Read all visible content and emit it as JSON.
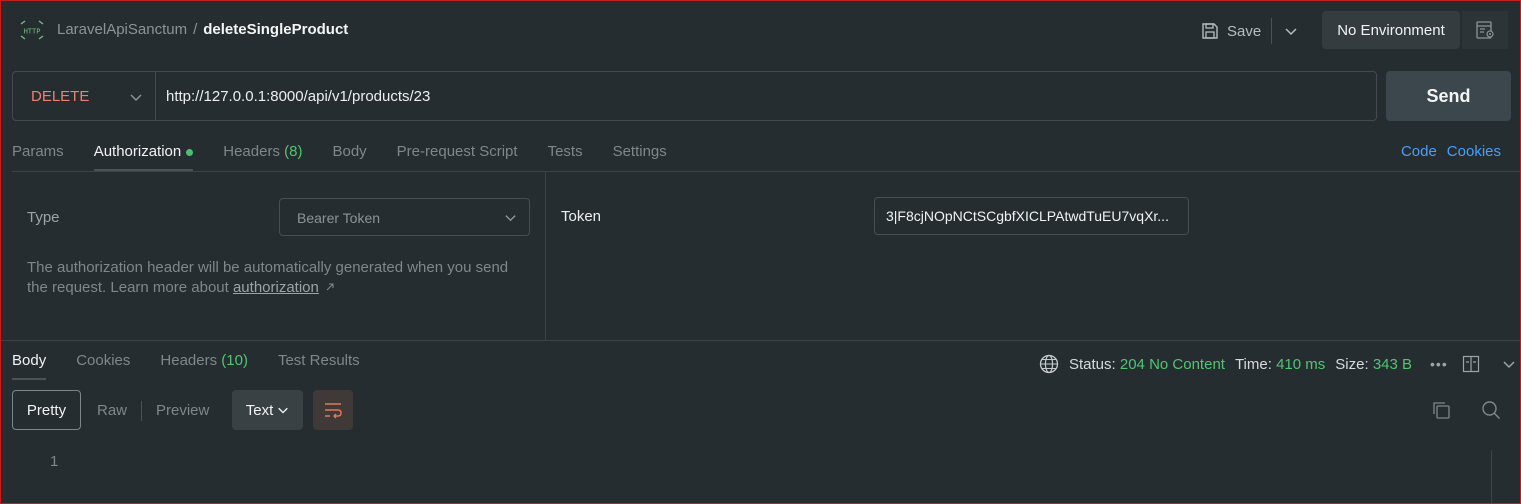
{
  "header": {
    "collection": "LaravelApiSanctum",
    "separator": "/",
    "request_name": "deleteSingleProduct",
    "save_label": "Save",
    "environment": "No Environment"
  },
  "request": {
    "method": "DELETE",
    "url": "http://127.0.0.1:8000/api/v1/products/23",
    "send_label": "Send",
    "tabs": [
      {
        "label": "Params"
      },
      {
        "label": "Authorization"
      },
      {
        "label": "Headers",
        "count": "(8)"
      },
      {
        "label": "Body"
      },
      {
        "label": "Pre-request Script"
      },
      {
        "label": "Tests"
      },
      {
        "label": "Settings"
      }
    ],
    "right_links": {
      "code": "Code",
      "cookies": "Cookies"
    }
  },
  "auth": {
    "type_label": "Type",
    "type_value": "Bearer Token",
    "description": "The authorization header will be automatically generated when you send the request. Learn more about ",
    "learn_link": "authorization",
    "token_label": "Token",
    "token_value": "3|F8cjNOpNCtSCgbfXICLPAtwdTuEU7vqXr..."
  },
  "response": {
    "tabs": [
      {
        "label": "Body"
      },
      {
        "label": "Cookies"
      },
      {
        "label": "Headers",
        "count": "(10)"
      },
      {
        "label": "Test Results"
      }
    ],
    "status_label": "Status:",
    "status_value": "204 No Content",
    "time_label": "Time:",
    "time_value": "410 ms",
    "size_label": "Size:",
    "size_value": "343 B",
    "more": "•••",
    "views": {
      "pretty": "Pretty",
      "raw": "Raw",
      "preview": "Preview"
    },
    "format": "Text",
    "line_number": "1"
  },
  "colors": {
    "method": "#f07f73",
    "success": "#4fc66f",
    "link": "#4c9ef3",
    "border_frame": "#c21f1f"
  },
  "icons": [
    "http-icon",
    "save-icon",
    "chevron-down-icon",
    "environment-quicklook-icon",
    "globe-icon",
    "layout-icon",
    "wrap-icon",
    "copy-icon",
    "search-icon",
    "external-link-icon"
  ]
}
